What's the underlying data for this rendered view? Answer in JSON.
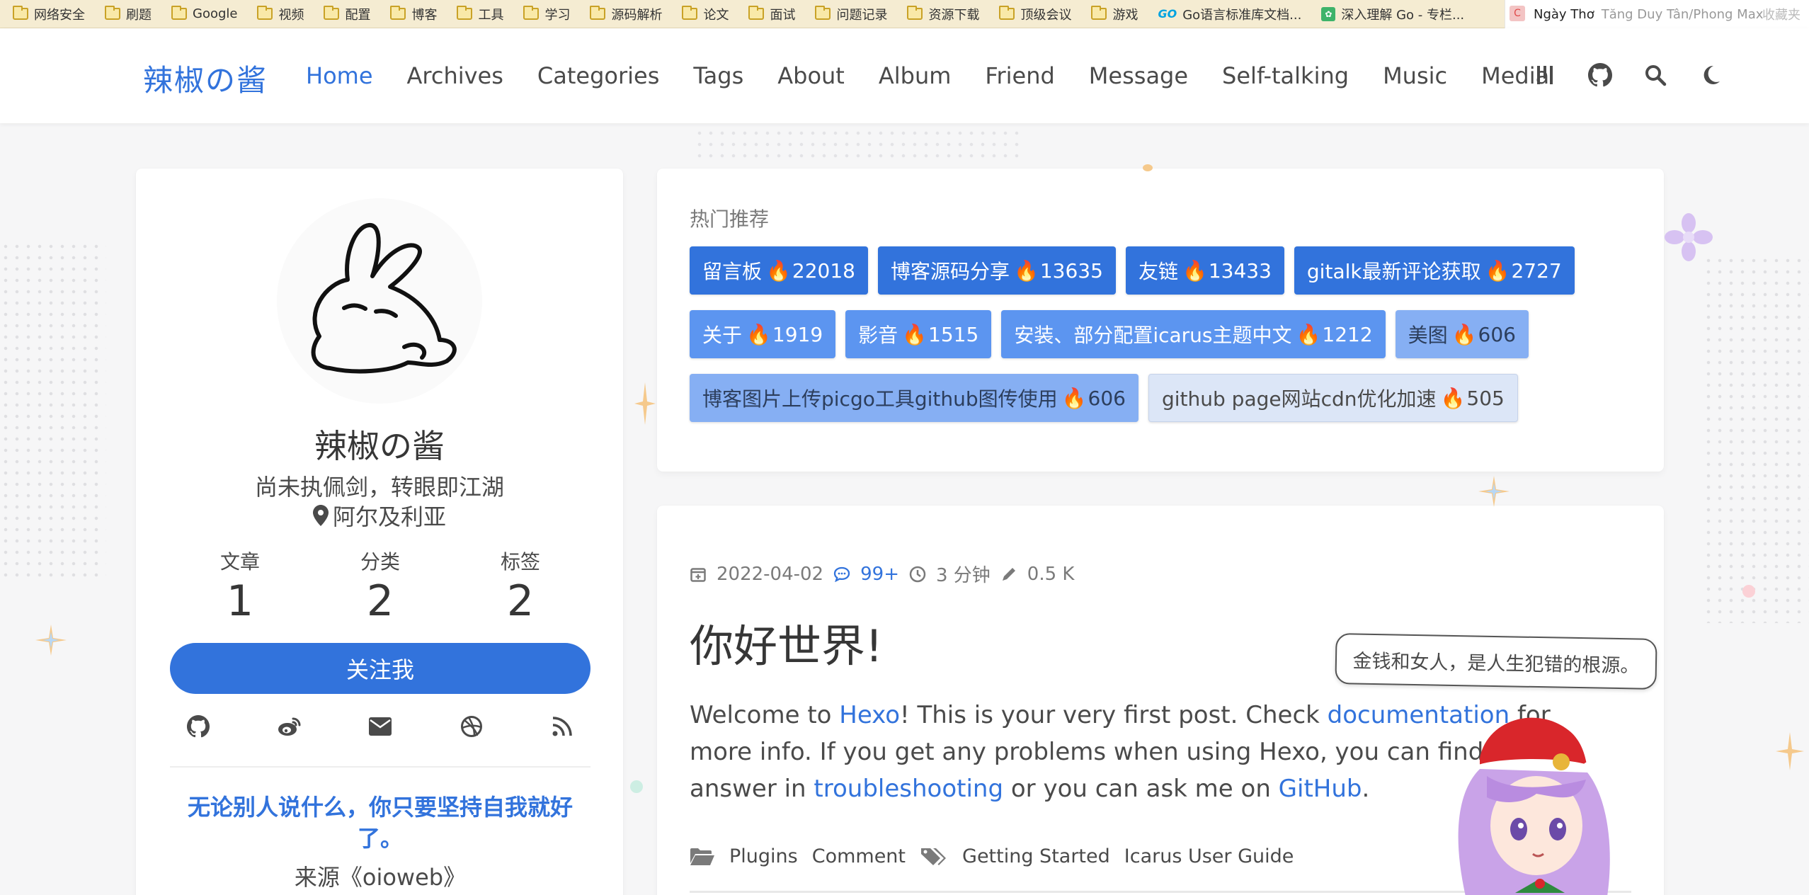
{
  "bookmarks": {
    "items": [
      {
        "label": "网络安全",
        "icon": "folder-icon"
      },
      {
        "label": "刷题",
        "icon": "folder-icon"
      },
      {
        "label": "Google",
        "icon": "folder-icon"
      },
      {
        "label": "视频",
        "icon": "folder-icon"
      },
      {
        "label": "配置",
        "icon": "folder-icon"
      },
      {
        "label": "博客",
        "icon": "folder-icon"
      },
      {
        "label": "工具",
        "icon": "folder-icon"
      },
      {
        "label": "学习",
        "icon": "folder-icon"
      },
      {
        "label": "源码解析",
        "icon": "folder-icon"
      },
      {
        "label": "论文",
        "icon": "folder-icon"
      },
      {
        "label": "面试",
        "icon": "folder-icon"
      },
      {
        "label": "问题记录",
        "icon": "folder-icon"
      },
      {
        "label": "资源下载",
        "icon": "folder-icon"
      },
      {
        "label": "顶级会议",
        "icon": "folder-icon"
      },
      {
        "label": "游戏",
        "icon": "folder-icon"
      }
    ],
    "go_doc": "Go语言标准库文档...",
    "go_deep": "深入理解 Go - 专栏...",
    "ext_text": "Ngày Thơ",
    "ext_sub": "Tăng Duy Tân/Phong Max",
    "ext_tail": "收藏夹"
  },
  "nav": {
    "logo": "辣椒の酱",
    "items": [
      "Home",
      "Archives",
      "Categories",
      "Tags",
      "About",
      "Album",
      "Friend",
      "Message",
      "Self-talking",
      "Music",
      "Media"
    ],
    "active": "Home"
  },
  "profile": {
    "name": "辣椒の酱",
    "motto": "尚未执佩剑，转眼即江湖",
    "location": "阿尔及利亚",
    "stats": [
      {
        "label": "文章",
        "value": "1"
      },
      {
        "label": "分类",
        "value": "2"
      },
      {
        "label": "标签",
        "value": "2"
      }
    ],
    "follow_label": "关注我",
    "quote": "无论别人说什么，你只要坚持自我就好了。",
    "quote_source": "来源《oioweb》"
  },
  "hot": {
    "title": "热门推荐",
    "tags": [
      {
        "label": "留言板",
        "count": "22018",
        "style": "t-dark"
      },
      {
        "label": "博客源码分享",
        "count": "13635",
        "style": "t-dark"
      },
      {
        "label": "友链",
        "count": "13433",
        "style": "t-dark"
      },
      {
        "label": "gitalk最新评论获取",
        "count": "2727",
        "style": "t-dark"
      },
      {
        "label": "关于",
        "count": "1919",
        "style": "t-mid"
      },
      {
        "label": "影音",
        "count": "1515",
        "style": "t-mid"
      },
      {
        "label": "安装、部分配置icarus主题中文",
        "count": "1212",
        "style": "t-mid"
      },
      {
        "label": "美图",
        "count": "606",
        "style": "t-light"
      },
      {
        "label": "博客图片上传picgo工具github图传使用",
        "count": "606",
        "style": "t-light"
      },
      {
        "label": "github page网站cdn优化加速",
        "count": "505",
        "style": "t-pale"
      }
    ]
  },
  "post": {
    "date": "2022-04-02",
    "comments": "99+",
    "read_time": "3 分钟",
    "words": "0.5 K",
    "title": "你好世界!",
    "body_1": "Welcome to ",
    "link_hexo": "Hexo",
    "body_2": "! This is your very first post. Check ",
    "link_docs": "documentation",
    "body_3": " for more info. If you get any problems when using Hexo, you can find the answer in ",
    "link_trouble": "troubleshooting",
    "body_4": " or you can ask me on ",
    "link_github": "GitHub",
    "body_5": ".",
    "categories": [
      "Plugins",
      "Comment"
    ],
    "tags": [
      "Getting Started",
      "Icarus User Guide"
    ]
  },
  "mascot": {
    "speech": "金钱和女人，是人生犯错的根源。"
  },
  "colors": {
    "accent": "#3273dc",
    "bookmark_bar": "#f5ecd2",
    "background": "#f6f6f7"
  }
}
